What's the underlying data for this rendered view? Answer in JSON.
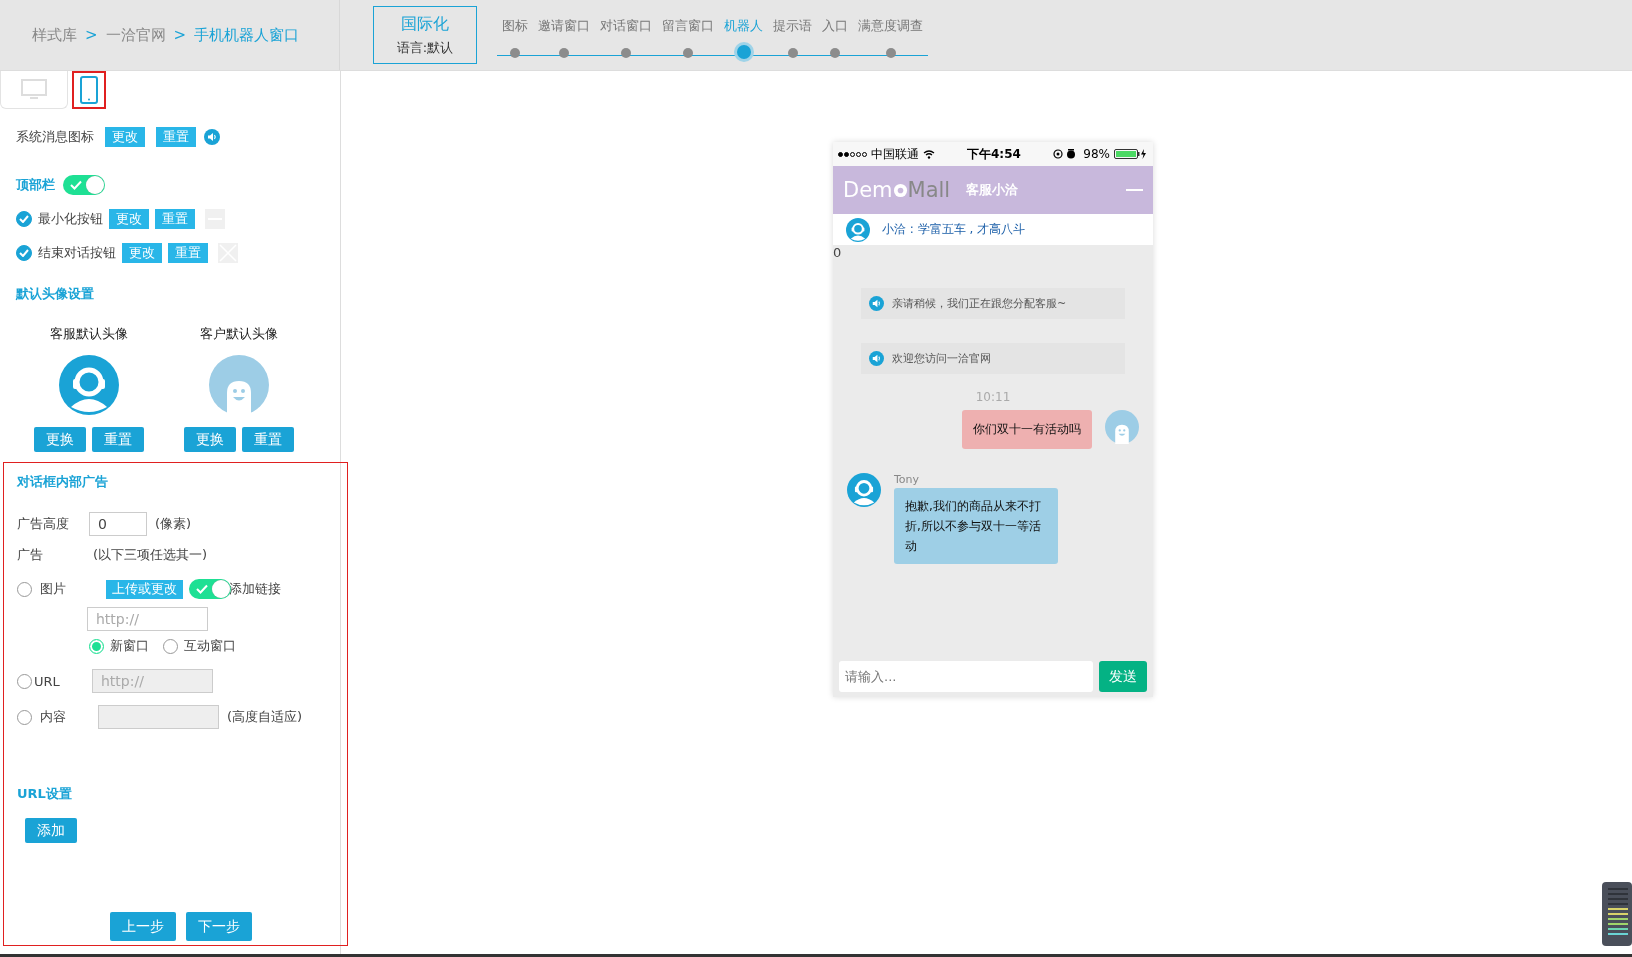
{
  "breadcrumb": [
    {
      "label": "样式库",
      "selected": false
    },
    {
      "label": "一洽官网",
      "separator_before": ">",
      "selected": false
    },
    {
      "label": "手机机器人窗口",
      "separator_before": ">",
      "selected": true
    }
  ],
  "locale_box": {
    "title": "国际化",
    "language": "语言:默认"
  },
  "steps": [
    {
      "label": "图标",
      "selected": false
    },
    {
      "label": "邀请窗口",
      "selected": false
    },
    {
      "label": "对话窗口",
      "selected": false
    },
    {
      "label": "留言窗口",
      "selected": false
    },
    {
      "label": "机器人",
      "selected": true
    },
    {
      "label": "提示语",
      "selected": false
    },
    {
      "label": "入口",
      "selected": false
    },
    {
      "label": "满意度调查",
      "selected": false
    }
  ],
  "device_tabs": [
    {
      "kind": "desktop",
      "selected": false
    },
    {
      "kind": "mobile",
      "selected": true
    }
  ],
  "system_icon": {
    "label": "系统消息图标",
    "buttons": [
      "更改",
      "重置"
    ]
  },
  "top_bar": {
    "title": "顶部栏",
    "on": true,
    "items": [
      {
        "kind": "minimize",
        "label": "最小化按钮",
        "checked": true,
        "buttons": [
          "更改",
          "重置"
        ]
      },
      {
        "kind": "close",
        "label": "结束对话按钮",
        "checked": true,
        "buttons": [
          "更改",
          "重置"
        ]
      }
    ]
  },
  "avatars": {
    "title": "默认头像设置",
    "items": [
      {
        "kind": "agent",
        "label": "客服默认头像",
        "buttons": [
          "更换",
          "重置"
        ]
      },
      {
        "kind": "customer",
        "label": "客户默认头像",
        "buttons": [
          "更换",
          "重置"
        ]
      }
    ]
  },
  "ad": {
    "title": "对话框内部广告",
    "highlighted": true,
    "height_label": "广告高度",
    "height_value": "0",
    "height_unit": "(像素)",
    "ad_label": "广告",
    "ad_hint": "(以下三项任选其一)",
    "options": [
      {
        "kind": "image",
        "label": "图片",
        "selected": false,
        "upload_button": "上传或更改",
        "link_on": true,
        "link_label": "添加链接",
        "link_placeholder": "http://",
        "targets": [
          {
            "label": "新窗口",
            "selected": true
          },
          {
            "label": "互动窗口",
            "selected": false
          }
        ]
      },
      {
        "kind": "url",
        "label": "URL",
        "selected": false,
        "placeholder": "http://"
      },
      {
        "kind": "content",
        "label": "内容",
        "selected": false,
        "note": "(高度自适应)"
      }
    ]
  },
  "url_settings": {
    "title": "URL设置",
    "add_button": "添加"
  },
  "nav_buttons": [
    "上一步",
    "下一步"
  ],
  "phone": {
    "status": {
      "carrier": "中国联通",
      "time": "下午4:54",
      "battery": "98%"
    },
    "header": {
      "logo_left": "Dem",
      "logo_right": "Mall",
      "title": "客服小洽"
    },
    "agent_bar": "小洽 : 学富五车 , 才高八斗",
    "ad_height_text": "0",
    "messages": [
      {
        "kind": "system",
        "text": "亲请稍候，我们正在跟您分配客服~"
      },
      {
        "kind": "system",
        "text": "欢迎您访问一洽官网"
      },
      {
        "kind": "time",
        "text": "10:11"
      },
      {
        "kind": "customer",
        "text": "你们双十一有活动吗"
      },
      {
        "kind": "agent",
        "name": "Tony",
        "text": "抱歉,我们的商品从来不打折,所以不参与双十一等活动"
      }
    ],
    "input": {
      "placeholder": "请输入...",
      "send": "发送"
    }
  }
}
